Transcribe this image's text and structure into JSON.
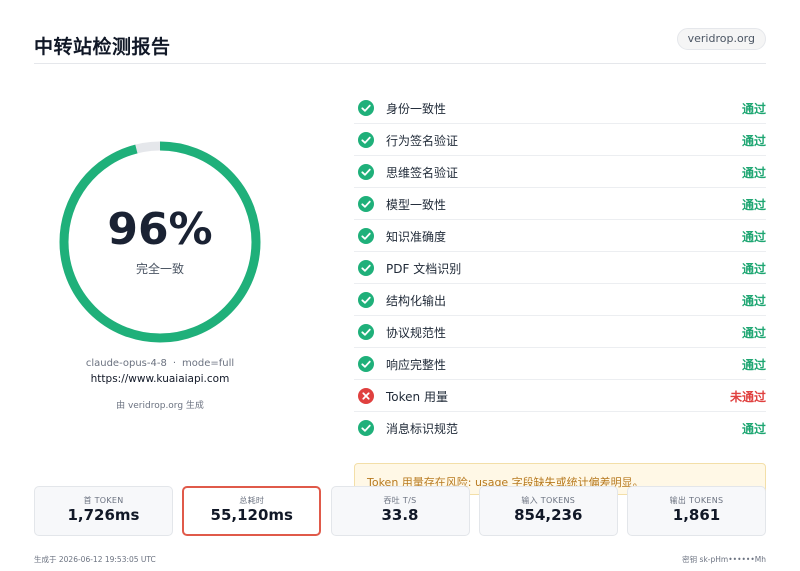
{
  "header": {
    "title": "中转站检测报告",
    "site": "veridrop.org"
  },
  "gauge": {
    "score": "96%",
    "score_value": 96,
    "verdict": "完全一致",
    "color": "#1fb07a"
  },
  "meta": {
    "model": "claude-opus-4-8",
    "separator": "·",
    "mode": "mode=full",
    "url": "https://www.kuaiaiapi.com",
    "generated_by": "由 veridrop.org 生成"
  },
  "checks": [
    {
      "name": "身份一致性",
      "status": "通过",
      "passed": true
    },
    {
      "name": "行为签名验证",
      "status": "通过",
      "passed": true
    },
    {
      "name": "思维签名验证",
      "status": "通过",
      "passed": true
    },
    {
      "name": "模型一致性",
      "status": "通过",
      "passed": true
    },
    {
      "name": "知识准确度",
      "status": "通过",
      "passed": true
    },
    {
      "name": "PDF 文档识别",
      "status": "通过",
      "passed": true
    },
    {
      "name": "结构化输出",
      "status": "通过",
      "passed": true
    },
    {
      "name": "协议规范性",
      "status": "通过",
      "passed": true
    },
    {
      "name": "响应完整性",
      "status": "通过",
      "passed": true
    },
    {
      "name": "Token 用量",
      "status": "未通过",
      "passed": false
    },
    {
      "name": "消息标识规范",
      "status": "通过",
      "passed": true
    }
  ],
  "warning": "Token 用量存在风险: usage 字段缺失或统计偏差明显。",
  "metrics": [
    {
      "label": "首 TOKEN",
      "value": "1,726ms"
    },
    {
      "label": "总耗时",
      "value": "55,120ms"
    },
    {
      "label": "吞吐 T/S",
      "value": "33.8"
    },
    {
      "label": "输入 TOKENS",
      "value": "854,236"
    },
    {
      "label": "输出 TOKENS",
      "value": "1,861"
    }
  ],
  "footer": {
    "generated_at": "生成于 2026-06-12 19:53:05 UTC",
    "key": "密钥 sk-pHm••••••Mh"
  },
  "colors": {
    "pass": "#1ea672",
    "fail": "#e0403f",
    "accent": "#1fb07a"
  }
}
